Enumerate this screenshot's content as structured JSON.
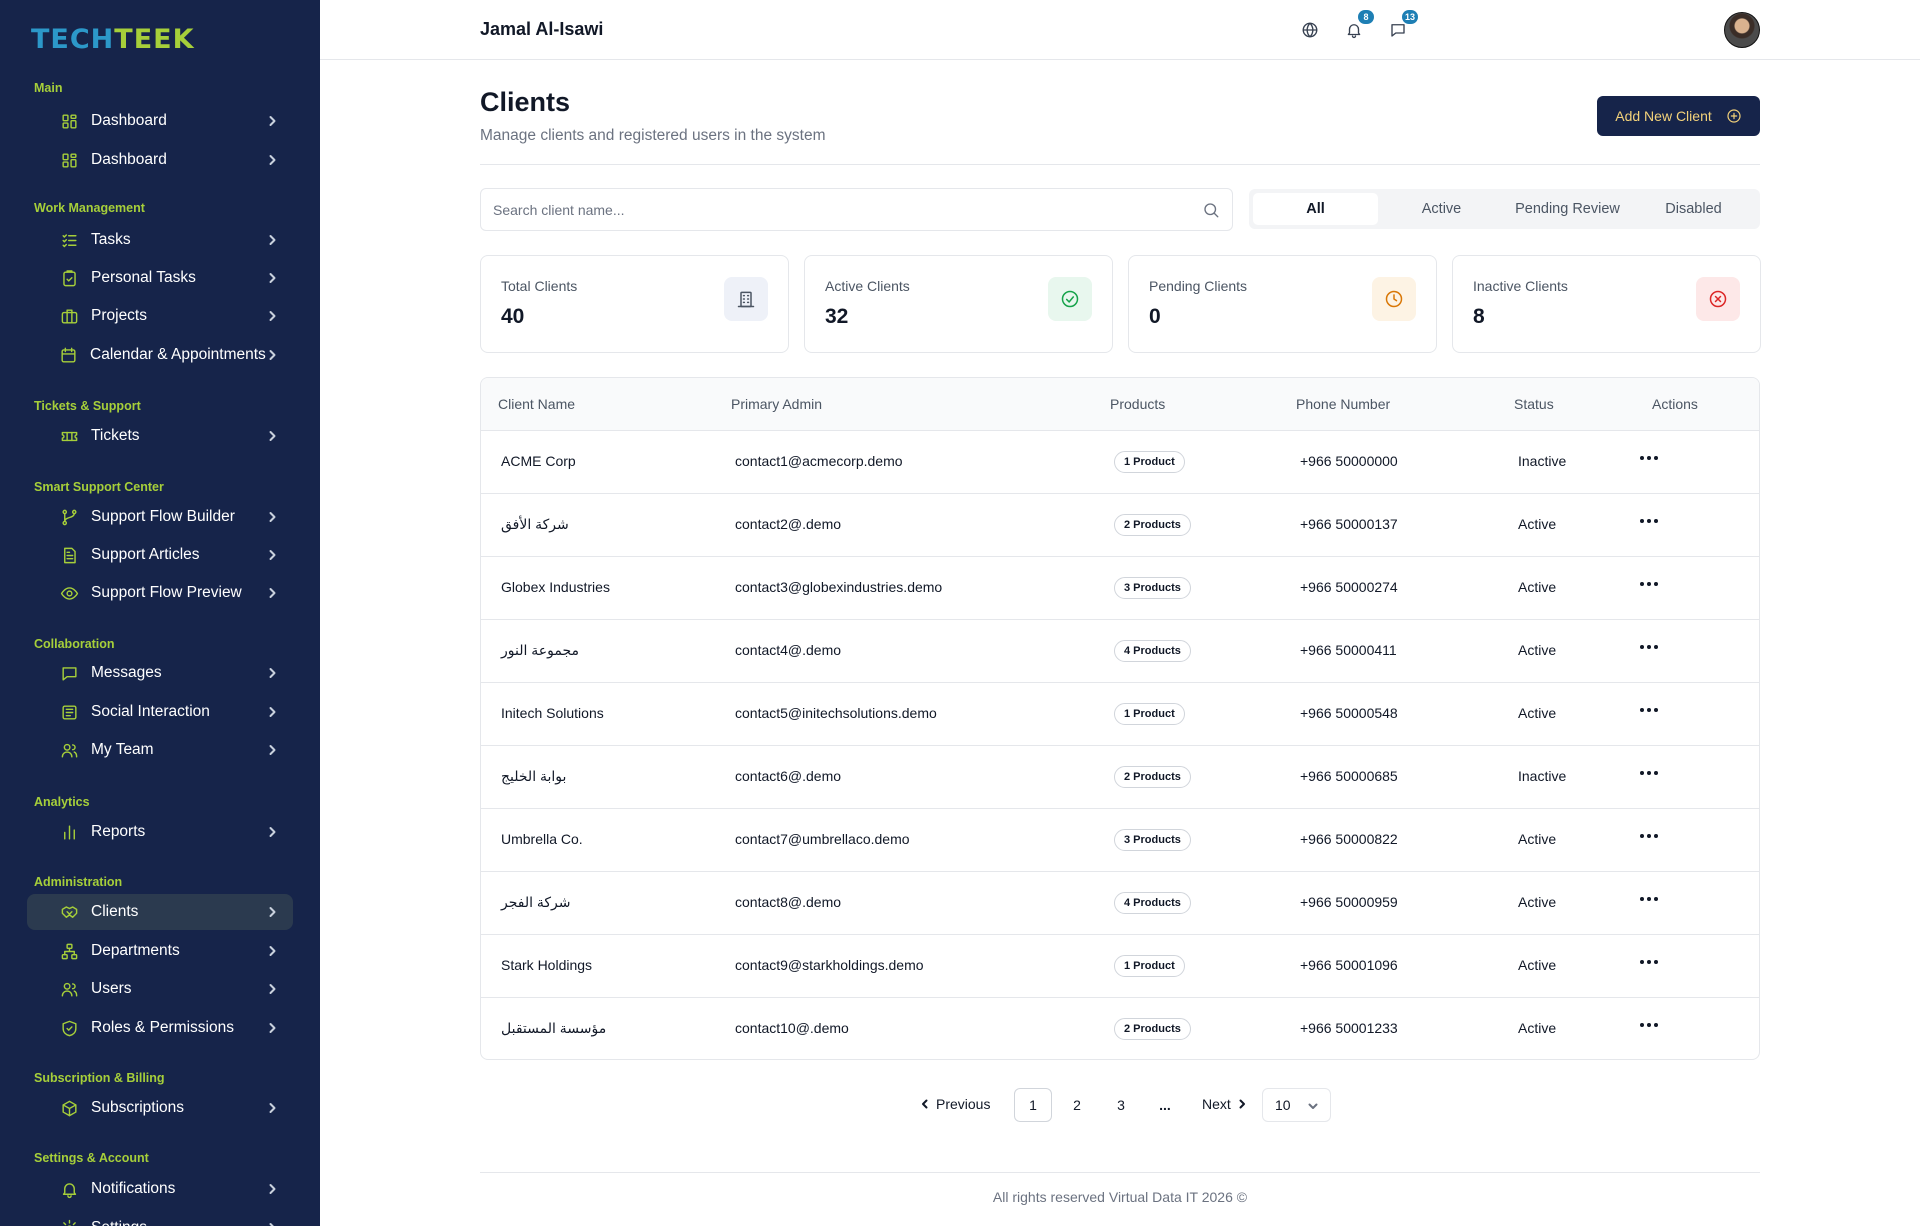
{
  "brand": {
    "part1": "TECH",
    "part2": "TEEK"
  },
  "sidebar": {
    "sections": [
      {
        "label": "Main",
        "items": [
          {
            "label": "Dashboard",
            "icon": "grid-icon"
          },
          {
            "label": "Dashboard",
            "icon": "grid-icon"
          }
        ]
      },
      {
        "label": "Work Management",
        "items": [
          {
            "label": "Tasks",
            "icon": "list-check-icon"
          },
          {
            "label": "Personal Tasks",
            "icon": "clipboard-check-icon"
          },
          {
            "label": "Projects",
            "icon": "briefcase-icon"
          },
          {
            "label": "Calendar & Appointments",
            "icon": "calendar-icon"
          }
        ]
      },
      {
        "label": "Tickets & Support",
        "items": [
          {
            "label": "Tickets",
            "icon": "ticket-icon"
          }
        ]
      },
      {
        "label": "Smart Support Center",
        "items": [
          {
            "label": "Support Flow Builder",
            "icon": "flow-icon"
          },
          {
            "label": "Support Articles",
            "icon": "document-icon"
          },
          {
            "label": "Support Flow Preview",
            "icon": "eye-icon"
          }
        ]
      },
      {
        "label": "Collaboration",
        "items": [
          {
            "label": "Messages",
            "icon": "message-icon"
          },
          {
            "label": "Social Interaction",
            "icon": "newspaper-icon"
          },
          {
            "label": "My Team",
            "icon": "users-icon"
          }
        ]
      },
      {
        "label": "Analytics",
        "items": [
          {
            "label": "Reports",
            "icon": "bar-chart-icon"
          }
        ]
      },
      {
        "label": "Administration",
        "items": [
          {
            "label": "Clients",
            "icon": "handshake-icon",
            "active": true
          },
          {
            "label": "Departments",
            "icon": "hierarchy-icon"
          },
          {
            "label": "Users",
            "icon": "users-icon"
          },
          {
            "label": "Roles & Permissions",
            "icon": "shield-check-icon"
          }
        ]
      },
      {
        "label": "Subscription & Billing",
        "items": [
          {
            "label": "Subscriptions",
            "icon": "box-icon"
          }
        ]
      },
      {
        "label": "Settings & Account",
        "items": [
          {
            "label": "Notifications",
            "icon": "bell-icon"
          },
          {
            "label": "Settings",
            "icon": "gear-icon"
          }
        ]
      }
    ]
  },
  "header": {
    "user_name": "Jamal Al-Isawi",
    "icons": {
      "language": "globe-icon",
      "notifications": "bell-icon",
      "messages": "message-icon"
    },
    "notification_count": "8",
    "message_count": "13"
  },
  "page": {
    "title": "Clients",
    "subtitle": "Manage clients and registered users in the system",
    "add_button": "Add New Client"
  },
  "search": {
    "placeholder": "Search client name...",
    "value": ""
  },
  "filters": {
    "tabs": [
      "All",
      "Active",
      "Pending Review",
      "Disabled"
    ],
    "selected": "All"
  },
  "stats": [
    {
      "label": "Total Clients",
      "value": "40",
      "icon": "building-icon",
      "color": "#4b5563",
      "bg": "#eef1f8"
    },
    {
      "label": "Active Clients",
      "value": "32",
      "icon": "check-circle-icon",
      "color": "#16a34a",
      "bg": "#e8f7ee"
    },
    {
      "label": "Pending Clients",
      "value": "0",
      "icon": "clock-icon",
      "color": "#d97706",
      "bg": "#fdf3e4"
    },
    {
      "label": "Inactive Clients",
      "value": "8",
      "icon": "x-circle-icon",
      "color": "#dc2626",
      "bg": "#fde8e8"
    }
  ],
  "table": {
    "columns": [
      "Client Name",
      "Primary Admin",
      "Products",
      "Phone Number",
      "Status",
      "Actions"
    ],
    "rows": [
      {
        "name": "ACME Corp",
        "admin": "contact1@acmecorp.demo",
        "products": "1 Product",
        "phone": "+966 50000000",
        "status": "Inactive"
      },
      {
        "name": "شركة الأفق",
        "admin": "contact2@.demo",
        "products": "2 Products",
        "phone": "+966 50000137",
        "status": "Active"
      },
      {
        "name": "Globex Industries",
        "admin": "contact3@globexindustries.demo",
        "products": "3 Products",
        "phone": "+966 50000274",
        "status": "Active"
      },
      {
        "name": "مجموعة النور",
        "admin": "contact4@.demo",
        "products": "4 Products",
        "phone": "+966 50000411",
        "status": "Active"
      },
      {
        "name": "Initech Solutions",
        "admin": "contact5@initechsolutions.demo",
        "products": "1 Product",
        "phone": "+966 50000548",
        "status": "Active"
      },
      {
        "name": "بوابة الخليج",
        "admin": "contact6@.demo",
        "products": "2 Products",
        "phone": "+966 50000685",
        "status": "Inactive"
      },
      {
        "name": "Umbrella Co.",
        "admin": "contact7@umbrellaco.demo",
        "products": "3 Products",
        "phone": "+966 50000822",
        "status": "Active"
      },
      {
        "name": "شركة الفجر",
        "admin": "contact8@.demo",
        "products": "4 Products",
        "phone": "+966 50000959",
        "status": "Active"
      },
      {
        "name": "Stark Holdings",
        "admin": "contact9@starkholdings.demo",
        "products": "1 Product",
        "phone": "+966 50001096",
        "status": "Active"
      },
      {
        "name": "مؤسسة المستقبل",
        "admin": "contact10@.demo",
        "products": "2 Products",
        "phone": "+966 50001233",
        "status": "Active"
      }
    ]
  },
  "pagination": {
    "previous": "Previous",
    "next": "Next",
    "pages": [
      "1",
      "2",
      "3"
    ],
    "current": "1",
    "ellipsis": "...",
    "page_size": "10"
  },
  "footer": {
    "text": "All rights reserved Virtual Data IT 2026 ©"
  }
}
